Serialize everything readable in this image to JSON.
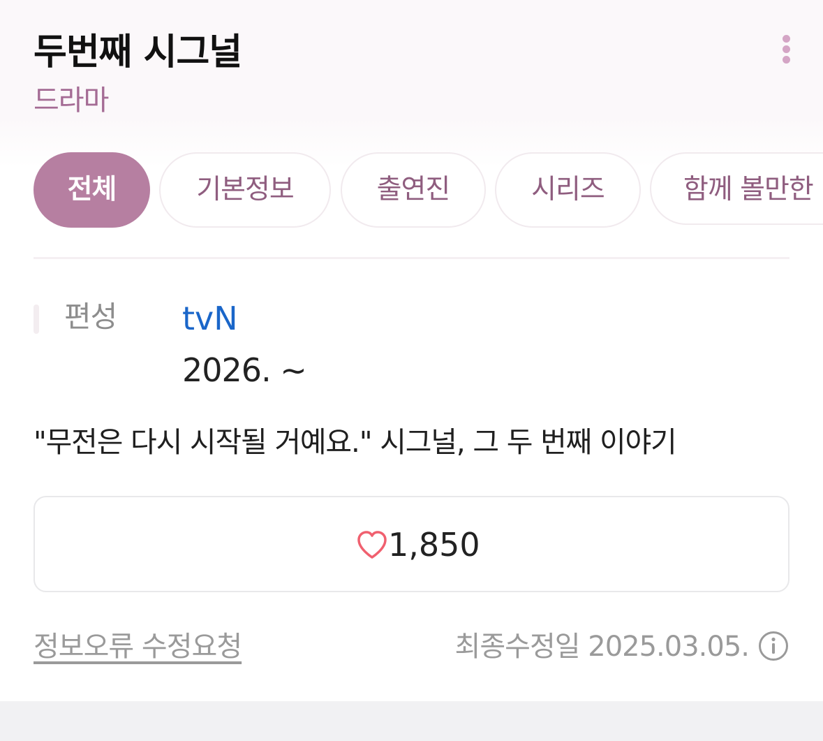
{
  "header": {
    "title": "두번째 시그널",
    "subtitle": "드라마",
    "more_icon": "more-vertical-icon"
  },
  "tabs": [
    {
      "label": "전체",
      "active": true
    },
    {
      "label": "기본정보",
      "active": false
    },
    {
      "label": "출연진",
      "active": false
    },
    {
      "label": "시리즈",
      "active": false
    },
    {
      "label": "함께 볼만한",
      "active": false
    }
  ],
  "info": {
    "label": "편성",
    "channel": "tvN",
    "air_date": "2026. ~"
  },
  "tagline": "\"무전은 다시 시작될 거예요.\" 시그널, 그 두 번째 이야기",
  "like": {
    "icon": "heart-outline-icon",
    "count": "1,850"
  },
  "footer": {
    "report_link": "정보오류 수정요청",
    "last_updated": "최종수정일 2025.03.05.",
    "info_icon": "info-circle-icon"
  },
  "colors": {
    "accent": "#b67fa1",
    "tab_text": "#8f5d7f",
    "subtitle": "#a46b94",
    "link": "#1a66c9",
    "heart": "#f0606f"
  }
}
